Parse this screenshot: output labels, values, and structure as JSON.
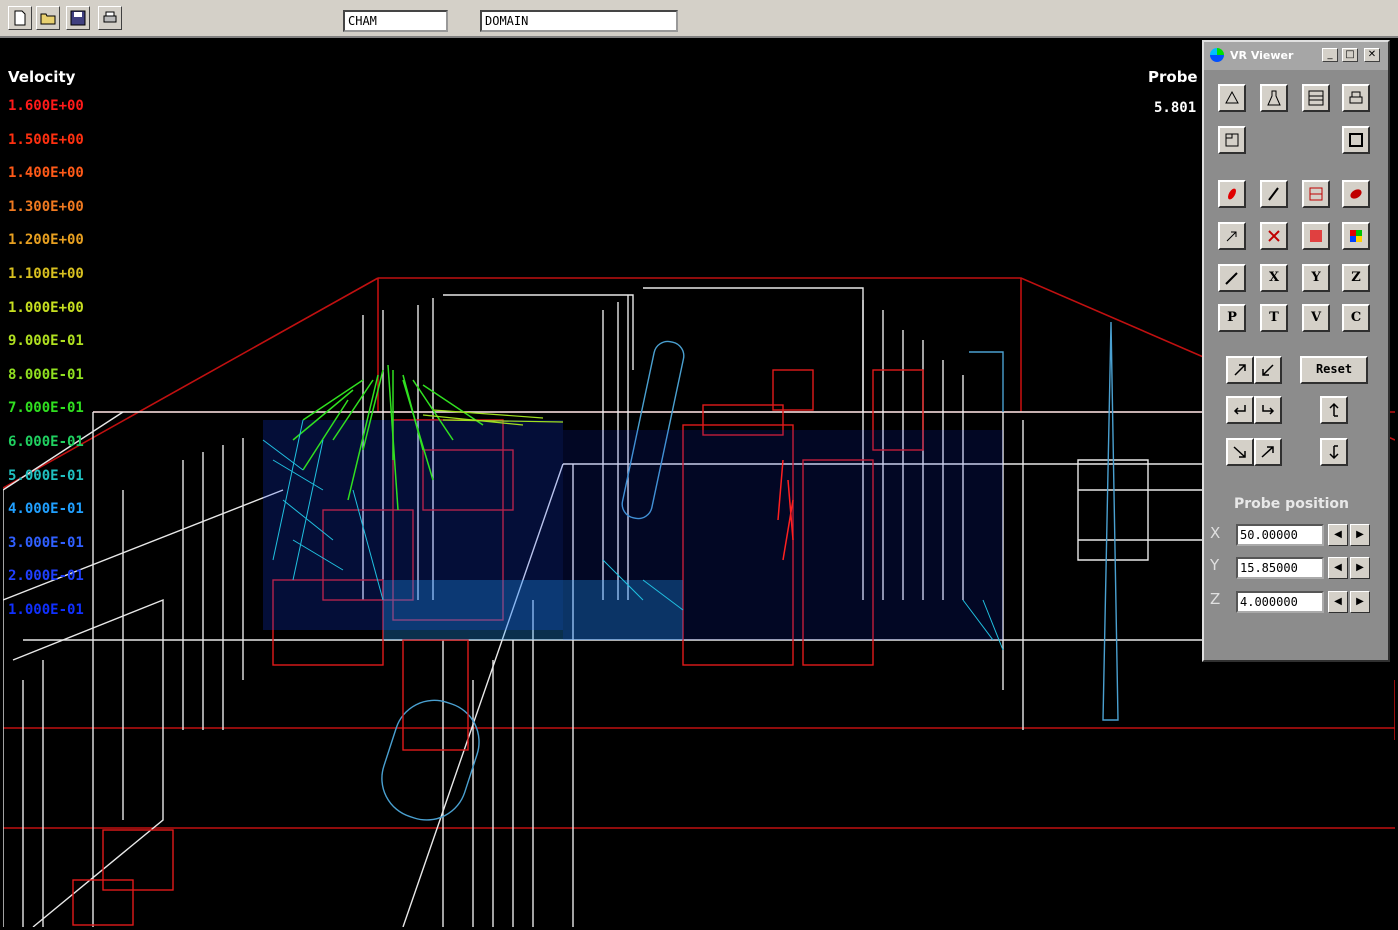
{
  "toolbar": {
    "icons": [
      "new-file-icon",
      "open-folder-icon",
      "save-icon",
      "print-icon"
    ],
    "field1": "CHAM",
    "field2": "DOMAIN"
  },
  "legend": {
    "title": "Velocity",
    "entries": [
      {
        "value": "1.600E+00",
        "color": "#ff1a1a"
      },
      {
        "value": "1.500E+00",
        "color": "#ff3010"
      },
      {
        "value": "1.400E+00",
        "color": "#ff5a18"
      },
      {
        "value": "1.300E+00",
        "color": "#f07a20"
      },
      {
        "value": "1.200E+00",
        "color": "#e8a020"
      },
      {
        "value": "1.100E+00",
        "color": "#d8c020"
      },
      {
        "value": "1.000E+00",
        "color": "#c8e020"
      },
      {
        "value": "9.000E-01",
        "color": "#b0e020"
      },
      {
        "value": "8.000E-01",
        "color": "#90e020"
      },
      {
        "value": "7.000E-01",
        "color": "#30e020"
      },
      {
        "value": "6.000E-01",
        "color": "#20d060"
      },
      {
        "value": "5.000E-01",
        "color": "#20c0c0"
      },
      {
        "value": "4.000E-01",
        "color": "#20a0ff"
      },
      {
        "value": "3.000E-01",
        "color": "#3060ff"
      },
      {
        "value": "2.000E-01",
        "color": "#2040ff"
      },
      {
        "value": "1.000E-01",
        "color": "#1030ff"
      }
    ]
  },
  "probe": {
    "label": "Probe",
    "value": "5.801"
  },
  "panel": {
    "title": "VR Viewer",
    "reset_label": "Reset",
    "letter_buttons": [
      "X",
      "Y",
      "Z",
      "P",
      "T",
      "V",
      "C"
    ],
    "probe_position_title": "Probe position",
    "coords": [
      {
        "axis": "X",
        "value": "50.00000"
      },
      {
        "axis": "Y",
        "value": "15.85000"
      },
      {
        "axis": "Z",
        "value": "4.000000"
      }
    ]
  }
}
